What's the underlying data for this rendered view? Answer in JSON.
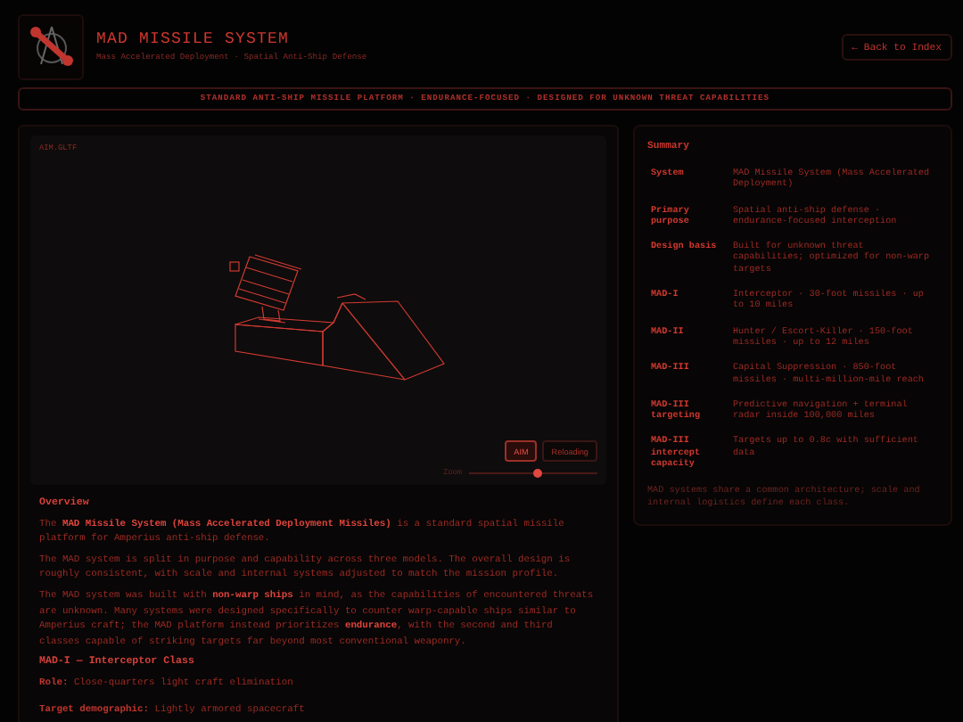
{
  "header": {
    "title": "MAD MISSILE SYSTEM",
    "subtitle": "Mass Accelerated Deployment · Spatial Anti-Ship Defense",
    "back_link": "← Back to Index"
  },
  "banner": "STANDARD ANTI-SHIP MISSILE PLATFORM · ENDURANCE-FOCUSED · DESIGNED FOR UNKNOWN THREAT CAPABILITIES",
  "viewer": {
    "file_label": "AIM.GLTF",
    "buttons": [
      {
        "label": "AIM",
        "selected": true
      },
      {
        "label": "Reloading",
        "selected": false
      }
    ],
    "zoom": {
      "label": "Zoom",
      "level": 0.54
    }
  },
  "overview": {
    "heading": "Overview",
    "paragraphs": [
      "The **MAD Missile System (Mass Accelerated Deployment Missiles)** is a standard spatial missile platform for Amperius anti-ship defense.",
      "The MAD system is split in purpose and capability across three models. The overall design is roughly consistent, with scale and internal systems adjusted to match the mission profile.",
      "The MAD system was built with **non-warp ships** in mind, as the capabilities of encountered threats are unknown. Many systems were designed specifically to counter warp-capable ships similar to Amperius craft; the MAD platform instead prioritizes **endurance**, with the second and third classes capable of striking targets far beyond most conventional weaponry."
    ]
  },
  "class_section": {
    "heading": "MAD-I — Interceptor Class",
    "fields": [
      {
        "label": "Role:",
        "value": "Close-quarters light craft elimination"
      },
      {
        "label": "Target demographic:",
        "value": "Lightly armored spacecraft"
      }
    ]
  },
  "summary": {
    "title": "Summary",
    "rows": [
      {
        "label": "System",
        "value": "MAD Missile System (Mass Accelerated Deployment)"
      },
      {
        "label": "Primary purpose",
        "value": "Spatial anti-ship defense · endurance-focused interception"
      },
      {
        "label": "Design basis",
        "value": "Built for unknown threat capabilities; optimized for non-warp targets"
      },
      {
        "label": "MAD-I",
        "value": "Interceptor · 30-foot missiles · up to 10 miles"
      },
      {
        "label": "MAD-II",
        "value": "Hunter / Escort-Killer · 150-foot missiles · up to 12 miles"
      },
      {
        "label": "MAD-III",
        "value": "Capital Suppression · 850-foot missiles · multi-million-mile reach"
      },
      {
        "label": "MAD-III targeting",
        "value": "Predictive navigation + terminal radar inside 100,000 miles"
      },
      {
        "label": "MAD-III intercept capacity",
        "value": "Targets up to 0.8c with sufficient data"
      }
    ],
    "footnote": "MAD systems share a common architecture; scale and internal logistics define each class."
  }
}
